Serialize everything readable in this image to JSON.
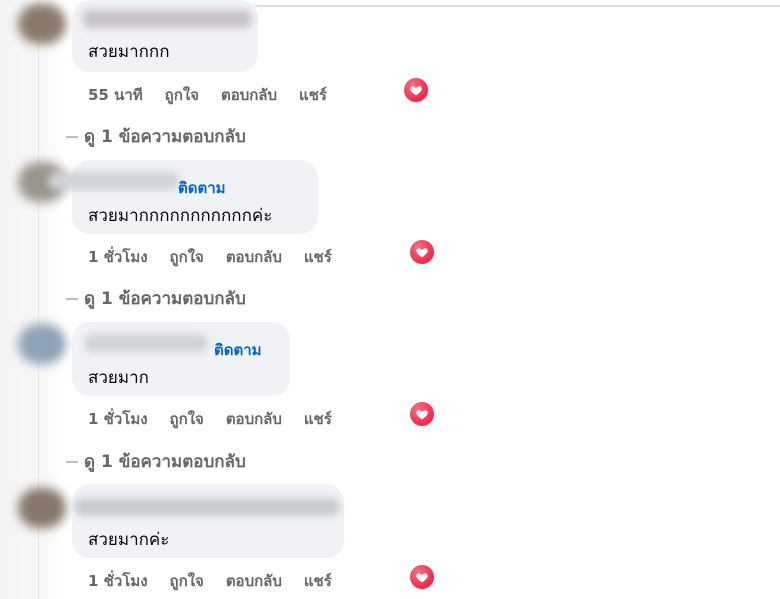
{
  "colors": {
    "link": "#0064d1",
    "meta": "#65676b",
    "bubble": "#f0f2f5",
    "heart": "#f02849"
  },
  "comments": [
    {
      "text": "สวยมากกก",
      "follow": "",
      "time": "55 นาที",
      "like": "ถูกใจ",
      "reply": "ตอบกลับ",
      "share": "แชร์",
      "reaction": "heart-icon",
      "view_replies": "ดู 1 ข้อความตอบกลับ"
    },
    {
      "text": "สวยมากกกกกกกกกกกค่ะ",
      "follow": "ติดตาม",
      "time": "1 ชั่วโมง",
      "like": "ถูกใจ",
      "reply": "ตอบกลับ",
      "share": "แชร์",
      "reaction": "heart-icon",
      "view_replies": "ดู 1 ข้อความตอบกลับ"
    },
    {
      "text": "สวยมาก",
      "follow": "ติดตาม",
      "time": "1 ชั่วโมง",
      "like": "ถูกใจ",
      "reply": "ตอบกลับ",
      "share": "แชร์",
      "reaction": "heart-icon",
      "view_replies": "ดู 1 ข้อความตอบกลับ"
    },
    {
      "text": "สวยมากค่ะ",
      "follow": "",
      "time": "1 ชั่วโมง",
      "like": "ถูกใจ",
      "reply": "ตอบกลับ",
      "share": "แชร์",
      "reaction": "heart-icon"
    }
  ]
}
